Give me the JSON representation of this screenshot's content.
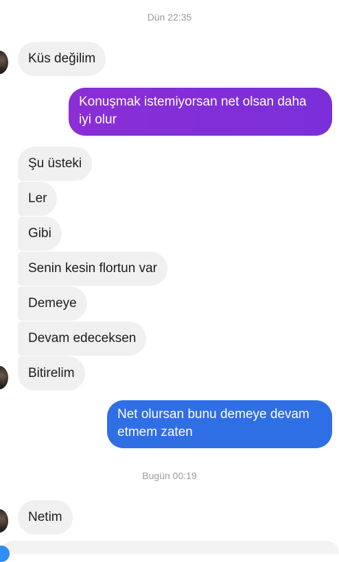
{
  "conversation": {
    "timestamp_1": "Dün 22:35",
    "timestamp_2": "Bugün 00:19",
    "messages": [
      {
        "direction": "incoming",
        "text": "Küs  değilim"
      },
      {
        "direction": "outgoing",
        "text": "Konuşmak istemiyorsan net olsan daha iyi olur",
        "color": "#8a2ed6"
      },
      {
        "direction": "incoming",
        "text": "Şu üsteki"
      },
      {
        "direction": "incoming",
        "text": "Ler"
      },
      {
        "direction": "incoming",
        "text": "Gibi"
      },
      {
        "direction": "incoming",
        "text": "Senin kesin flortun var"
      },
      {
        "direction": "incoming",
        "text": "Demeye"
      },
      {
        "direction": "incoming",
        "text": "Devam edeceksen"
      },
      {
        "direction": "incoming",
        "text": "Bitirelim"
      },
      {
        "direction": "outgoing",
        "text": "Net olursan bunu demeye devam etmem zaten",
        "color": "#2f6fe6"
      },
      {
        "direction": "incoming",
        "text": "Netim"
      }
    ]
  },
  "colors": {
    "incoming_bubble": "#f0f0f0",
    "outgoing_purple": "#8a2ed6",
    "outgoing_blue": "#2f6fe6"
  },
  "icons": {
    "avatar": "contact-avatar",
    "composer_plus": "plus-icon"
  }
}
